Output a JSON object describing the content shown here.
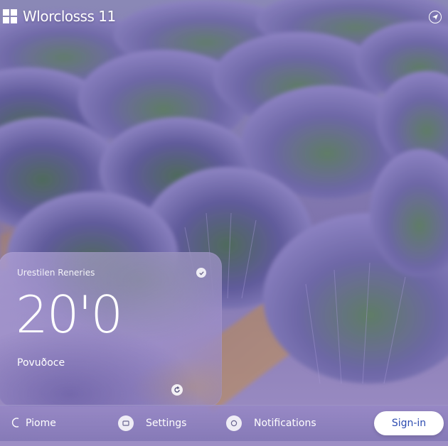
{
  "header": {
    "brand": "Wlorclosss 11",
    "brand_icon": "windows-logo-icon",
    "top_right_icon": "navigation-icon"
  },
  "widget": {
    "title": "Urestilen Reneries",
    "value": "20'0",
    "subtitle": "Povuðoce",
    "check_icon": "check-circle-icon",
    "refresh_icon": "refresh-icon"
  },
  "taskbar": {
    "items": [
      {
        "label": "Piome",
        "icon": "home-ring-icon"
      },
      {
        "label": "Settings",
        "icon": "settings-square-icon"
      },
      {
        "label": "Notifications",
        "icon": "notification-circle-icon"
      }
    ],
    "signin_label": "Sign-in"
  },
  "colors": {
    "lavender": "#7d76a8",
    "signin_text": "#2c4bb0",
    "widget_tint": "#c3b4e1"
  }
}
